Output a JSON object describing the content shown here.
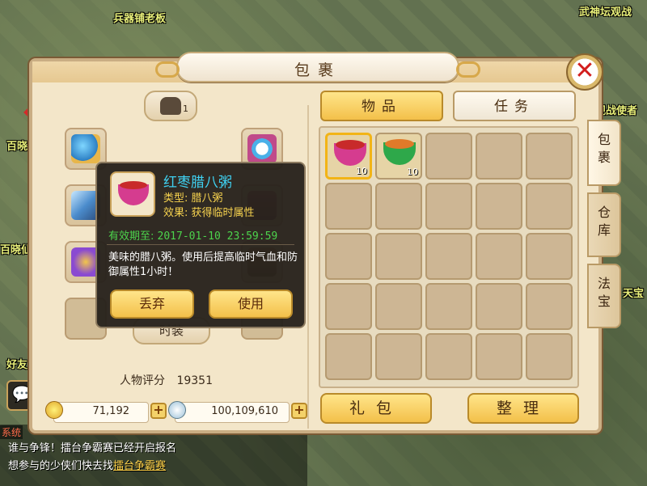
{
  "background": {
    "labels": [
      "兵器铺老板",
      "武神坛观战",
      "观战使者",
      "百晓",
      "百晓仙",
      "天宝",
      "好友"
    ],
    "chat_tag": "系统",
    "chat_lines": [
      "谁与争锋！擂台争霸赛已经开启报名",
      "想参与的少侠们快去找",
      "擂台争霸赛"
    ]
  },
  "panel": {
    "title": "包裹",
    "close_label": "✕"
  },
  "equipment": {
    "fashion_count": "1",
    "fashion_label": "时装",
    "score_label": "人物评分",
    "score_value": "19351",
    "currency": {
      "gold_value": "71,192",
      "silver_value": "100,109,610",
      "plus_label": "+"
    }
  },
  "tabs": {
    "items_label": "物品",
    "tasks_label": "任务"
  },
  "side_tabs": [
    "包裹",
    "仓库",
    "法宝"
  ],
  "grid": {
    "rows": 5,
    "cols": 5,
    "items": [
      {
        "name": "红枣腊八粥",
        "qty": "10",
        "selected": true,
        "bowl_color": "#d53c8f",
        "food_color": "#c82a2a"
      },
      {
        "name": "腊八粥",
        "qty": "10",
        "selected": false,
        "bowl_color": "#2ea84a",
        "food_color": "#e07a2a"
      }
    ]
  },
  "bottom_buttons": {
    "gift_label": "礼包",
    "sort_label": "整理"
  },
  "tooltip": {
    "name": "红枣腊八粥",
    "type_line": "类型: 腊八粥",
    "effect_line": "效果: 获得临时属性",
    "expiry_label": "有效期至:",
    "expiry_value": "2017-01-10 23:59:59",
    "description": "美味的腊八粥。使用后提高临时气血和防御属性1小时！",
    "discard_label": "丢弃",
    "use_label": "使用"
  },
  "colors": {
    "accent_gold": "#f3c04a",
    "panel_bg": "#f3e6c9",
    "tooltip_name": "#3fd0f0",
    "tooltip_attr": "#f7d34f",
    "tooltip_expiry": "#4cd34c"
  }
}
